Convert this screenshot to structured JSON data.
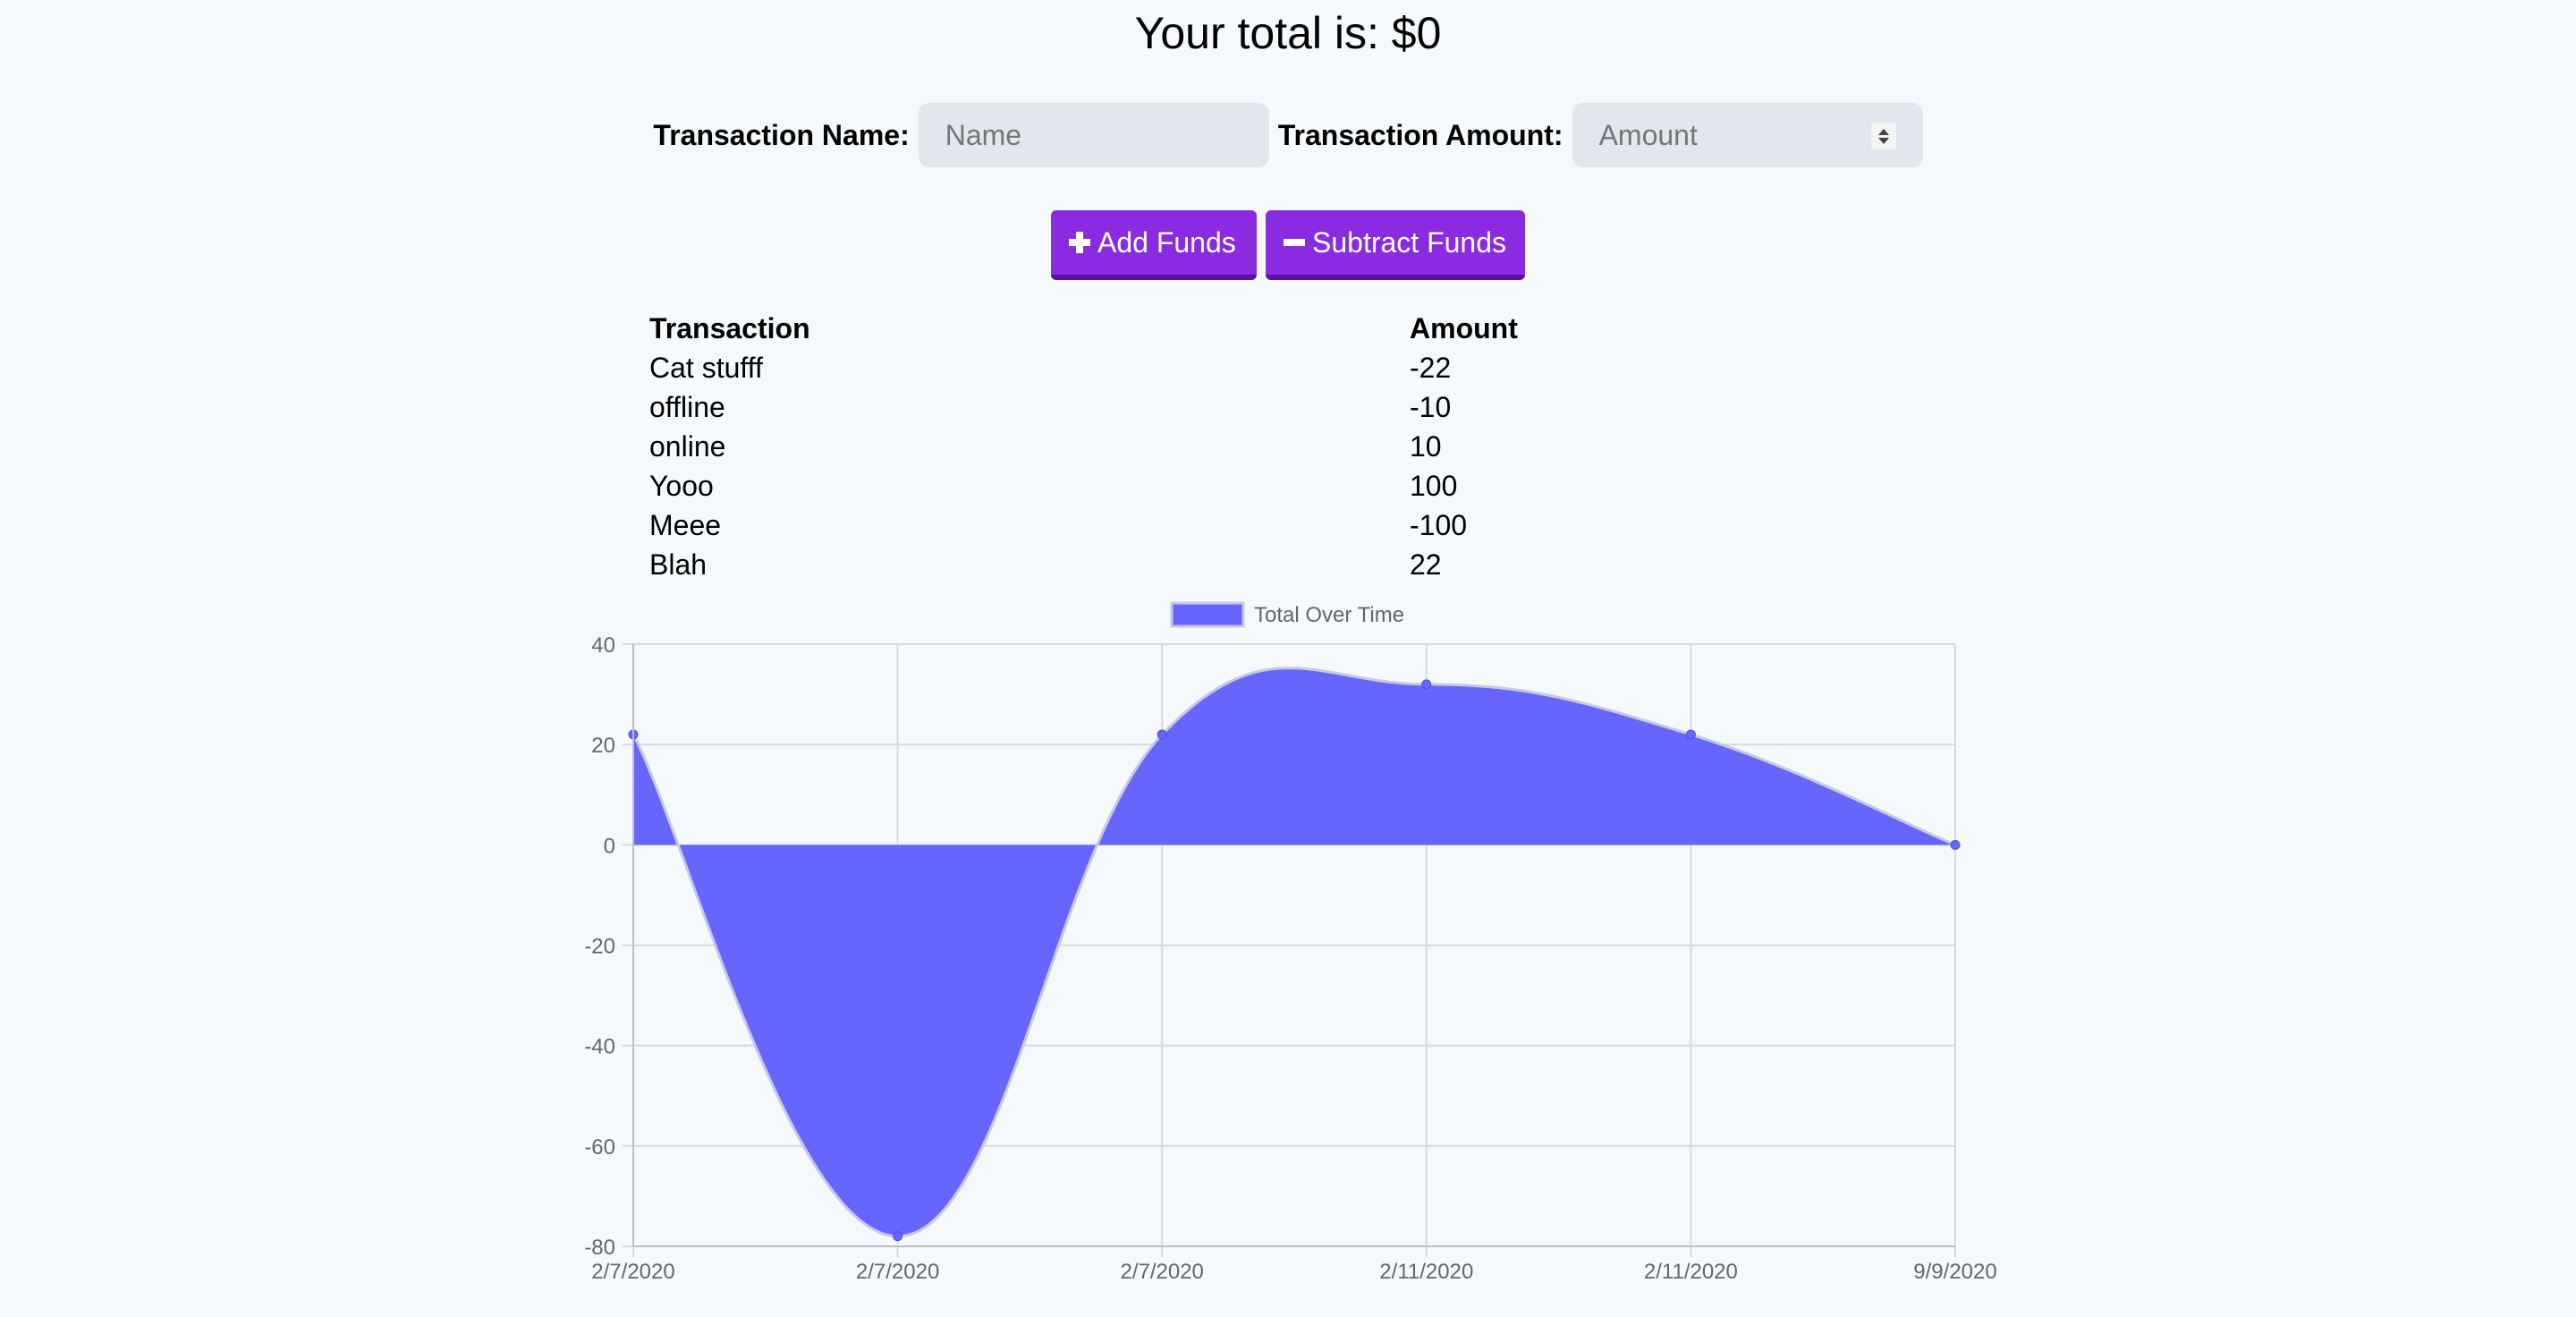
{
  "header": {
    "total_text": "Your total is: $0"
  },
  "form": {
    "name_label": "Transaction Name:",
    "name_placeholder": "Name",
    "amount_label": "Transaction Amount:",
    "amount_placeholder": "Amount"
  },
  "buttons": {
    "add_label": "Add Funds",
    "subtract_label": "Subtract Funds"
  },
  "table": {
    "headers": [
      "Transaction",
      "Amount"
    ],
    "rows": [
      [
        "Cat stufff",
        "-22"
      ],
      [
        "offline",
        "-10"
      ],
      [
        "online",
        "10"
      ],
      [
        "Yooo",
        "100"
      ],
      [
        "Meee",
        "-100"
      ],
      [
        "Blah",
        "22"
      ]
    ]
  },
  "colors": {
    "accent": "#8a2be2",
    "series_fill": "#6666ff",
    "page_background": "#f5f9fc"
  },
  "chart_data": {
    "type": "area",
    "x": [
      "2/7/2020",
      "2/7/2020",
      "2/7/2020",
      "2/11/2020",
      "2/11/2020",
      "9/9/2020"
    ],
    "series": [
      {
        "name": "Total Over Time",
        "values": [
          22,
          -78,
          22,
          32,
          22,
          0
        ]
      }
    ],
    "ylim": [
      -80,
      40
    ],
    "yticks": [
      40,
      20,
      0,
      -20,
      -40,
      -60,
      -80
    ],
    "grid": true,
    "legend": "top-center",
    "title": "",
    "xlabel": "",
    "ylabel": ""
  }
}
